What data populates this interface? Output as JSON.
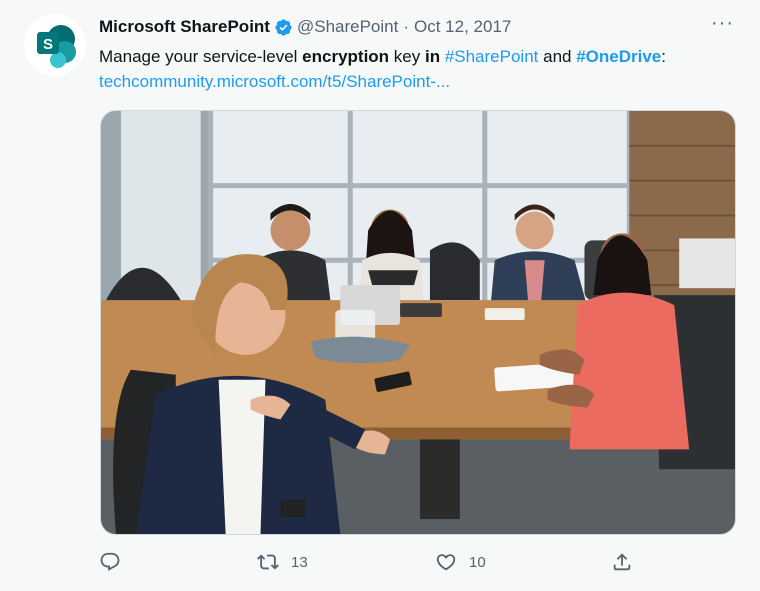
{
  "author": {
    "display_name": "Microsoft SharePoint",
    "handle": "@SharePoint",
    "separator": "·",
    "date": "Oct 12, 2017",
    "avatar_letter": "S",
    "verified_color": "#1d9bf0"
  },
  "more_label": "···",
  "body": {
    "part1": "Manage your service-level ",
    "bold1": "encryption",
    "part2": " key ",
    "bold2": "in",
    "part3": " ",
    "hashtag1": "#SharePoint",
    "part4": " and ",
    "hashtag2": "#OneDrive",
    "part5": ":",
    "link": "techcommunity.microsoft.com/t5/SharePoint-..."
  },
  "media": {
    "icon": "photo-of-meeting"
  },
  "actions": {
    "reply_count": "",
    "retweet_count": "13",
    "like_count": "10",
    "reply_icon": "reply-icon",
    "retweet_icon": "retweet-icon",
    "like_icon": "heart-icon",
    "share_icon": "share-icon"
  },
  "colors": {
    "link": "#1d9bf0",
    "muted": "#536471",
    "text": "#0f1419",
    "background": "#f7f9f9"
  }
}
